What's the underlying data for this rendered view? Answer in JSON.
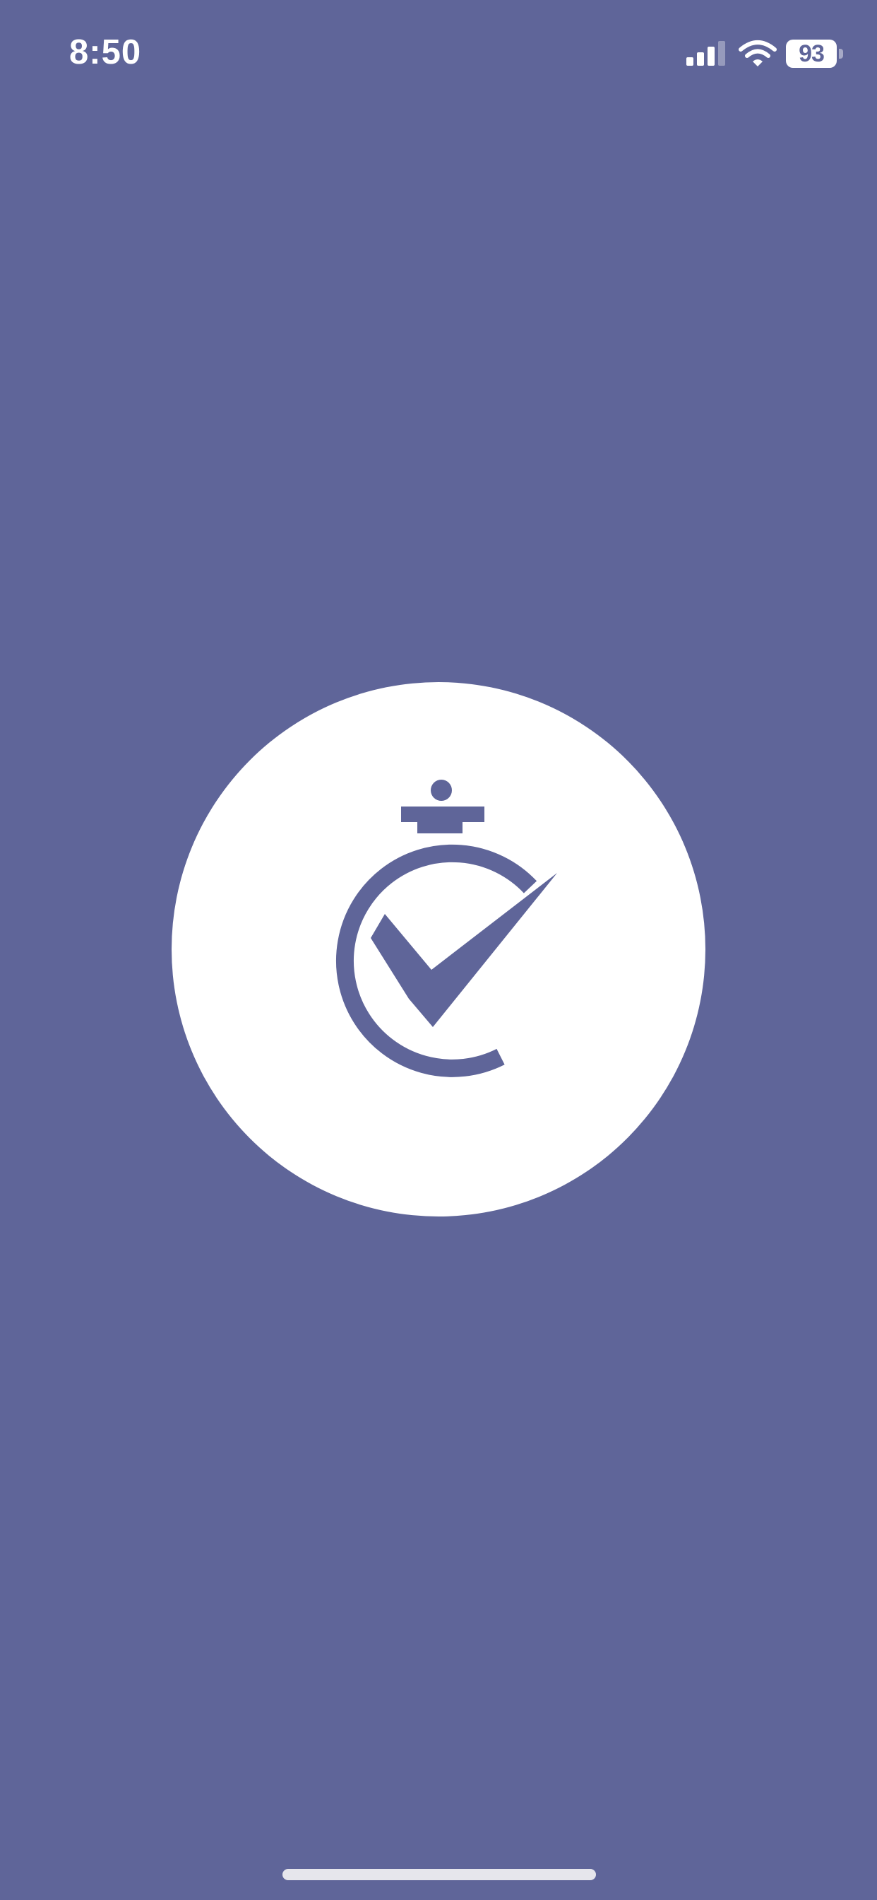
{
  "status_bar": {
    "time": "8:50",
    "battery_level": "93",
    "icons": [
      "signal-icon",
      "wifi-icon",
      "battery-icon"
    ]
  },
  "splash": {
    "logo": "stopwatch-check-icon"
  },
  "colors": {
    "background": "#5f6599",
    "logo_circle": "#ffffff",
    "logo_mark": "#5f6599",
    "logo_accent_arc": "#808080"
  }
}
